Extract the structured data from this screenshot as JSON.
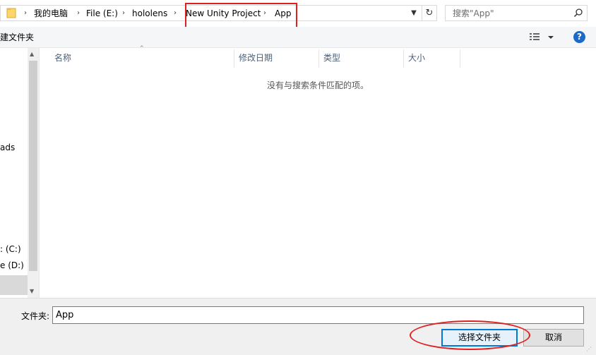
{
  "address": {
    "breadcrumbs": [
      "我的电脑",
      "File (E:)",
      "hololens",
      "New Unity Project",
      "App"
    ],
    "search_placeholder": "搜索\"App\""
  },
  "toolbar": {
    "new_folder_label": "建文件夹",
    "help_label": "?"
  },
  "nav": {
    "items": [
      "ads",
      ": (C:)",
      "e (D:)"
    ]
  },
  "columns": [
    "名称",
    "修改日期",
    "类型",
    "大小"
  ],
  "list": {
    "empty_message": "没有与搜索条件匹配的项。"
  },
  "bottom": {
    "filename_label": "文件夹:",
    "filename_value": "App",
    "select_button": "选择文件夹",
    "cancel_button": "取消"
  },
  "colors": {
    "accent": "#0078d7",
    "annotation": "#e02020",
    "help": "#1b6ac9"
  },
  "icons": [
    "folder-icon",
    "chevron-right-icon",
    "chevron-down-icon",
    "refresh-icon",
    "search-icon",
    "view-options-icon",
    "help-icon"
  ]
}
